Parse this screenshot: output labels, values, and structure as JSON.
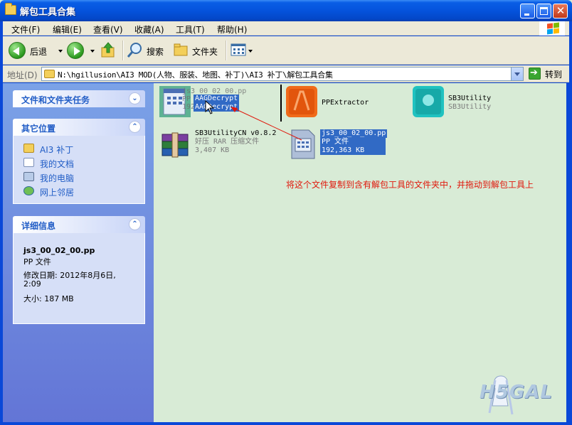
{
  "window": {
    "title": "解包工具合集"
  },
  "menu": [
    "文件(F)",
    "编辑(E)",
    "查看(V)",
    "收藏(A)",
    "工具(T)",
    "帮助(H)"
  ],
  "toolbar": {
    "back": "后退",
    "search": "搜索",
    "folders": "文件夹"
  },
  "address": {
    "label": "地址(D)",
    "path": "N:\\hgillusion\\AI3 MOD(人物、服装、地图、补丁)\\AI3 补丁\\解包工具合集",
    "go": "转到"
  },
  "taskpane": {
    "tasks_title": "文件和文件夹任务",
    "other_title": "其它位置",
    "places": [
      {
        "label": "AI3 补丁",
        "icon": "folder-icon"
      },
      {
        "label": "我的文档",
        "icon": "my-documents-icon"
      },
      {
        "label": "我的电脑",
        "icon": "my-computer-icon"
      },
      {
        "label": "网上邻居",
        "icon": "network-icon"
      }
    ],
    "details_title": "详细信息",
    "details": {
      "name": "js3_00_02_00.pp",
      "type": "PP 文件",
      "modified": "修改日期: 2012年8月6日,",
      "time": "2:09",
      "size": "大小: 187 MB"
    }
  },
  "files": {
    "aa": {
      "name": "AAGDecrypt",
      "sub": "AAGDecrypt"
    },
    "drag_ghost": {
      "name": "js3_00_02_00.pp",
      "sub1": "PP 文件",
      "sub2": "192,363 KB"
    },
    "pp": {
      "name": "PPExtractor"
    },
    "sb3": {
      "name": "SB3Utility",
      "sub": "SB3Utility"
    },
    "sb3cn": {
      "name": "SB3UtilityCN v0.8.2",
      "sub1": "好压 RAR 压缩文件",
      "sub2": "3,407 KB"
    },
    "js3": {
      "name": "js3_00_02_00.pp",
      "sub1": "PP 文件",
      "sub2": "192,363 KB"
    }
  },
  "annotation": "将这个文件复制到含有解包工具的文件夹中，并拖动到解包工具上",
  "watermark": "H5GAL",
  "colors": {
    "titlebar": "#0553dc",
    "content_bg": "#d8ebd6",
    "annotation": "#e0180c",
    "selection": "#316ac5"
  }
}
